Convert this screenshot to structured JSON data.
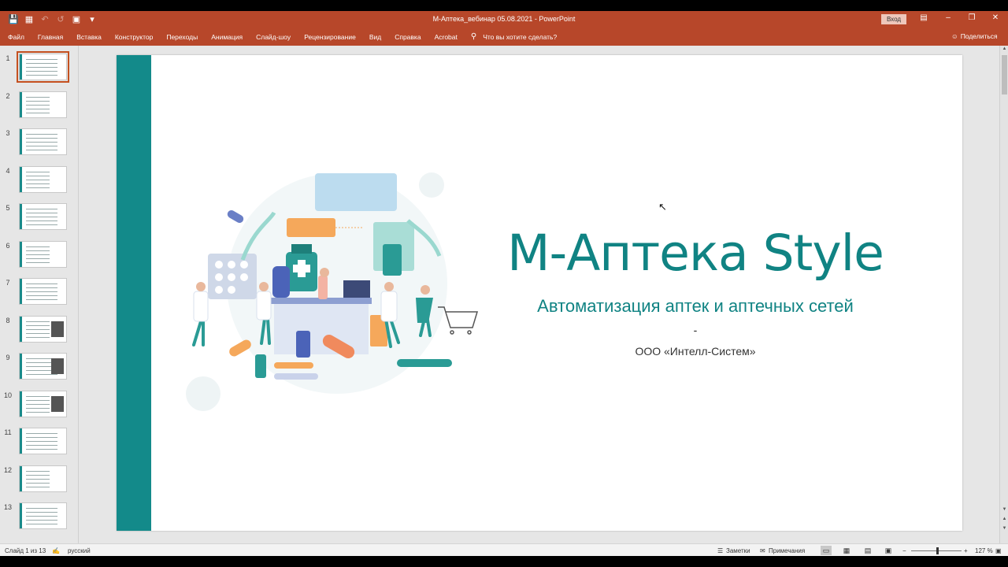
{
  "window": {
    "title": "М-Аптека_вебинар 05.08.2021  -  PowerPoint",
    "signin_label": "Вход",
    "quick_access": [
      "save-icon",
      "autosave-icon",
      "undo-icon",
      "redo-icon",
      "present-icon",
      "customize-icon"
    ]
  },
  "ribbon": {
    "tabs": [
      "Файл",
      "Главная",
      "Вставка",
      "Конструктор",
      "Переходы",
      "Анимация",
      "Слайд-шоу",
      "Рецензирование",
      "Вид",
      "Справка",
      "Acrobat"
    ],
    "tell_me": "Что вы хотите сделать?",
    "share": "Поделиться"
  },
  "thumbnails": {
    "numbers": [
      "1",
      "2",
      "3",
      "4",
      "5",
      "6",
      "7",
      "8",
      "9",
      "10",
      "11",
      "12",
      "13"
    ],
    "selected": "1"
  },
  "slide": {
    "title": "М-Аптека Style",
    "subtitle": "Автоматизация аптек и аптечных сетей",
    "dash": "-",
    "organization": "ООО «Интелл-Систем»"
  },
  "status": {
    "slide_counter": "Слайд 1 из 13",
    "language": "русский",
    "notes": "Заметки",
    "comments": "Примечания",
    "zoom": "127 %",
    "zoom_minus": "−",
    "zoom_plus": "+"
  },
  "colors": {
    "ribbon": "#b7472a",
    "teal": "#138a8a",
    "selection": "#c4501f"
  }
}
